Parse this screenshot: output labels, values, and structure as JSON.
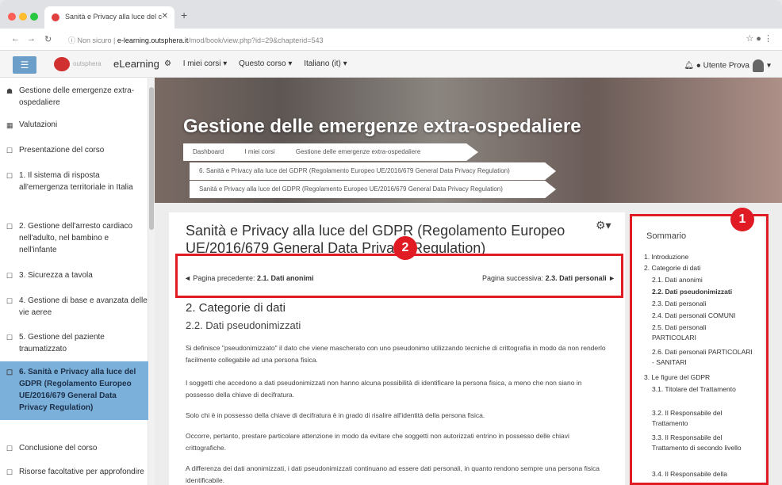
{
  "browser": {
    "tab_title": "Sanità e Privacy alla luce del c",
    "url_prefix": "Non sicuro | ",
    "url_host": "e-learning.outsphera.it",
    "url_path": "/mod/book/view.php?id=29&chapterid=543"
  },
  "topnav": {
    "brand": "outsphera",
    "brand_name": "eLearning",
    "items": [
      "I miei corsi ▾",
      "Questo corso ▾",
      "Italiano (it) ▾"
    ],
    "user": "Utente Prova"
  },
  "sidebar": {
    "items": [
      {
        "icon": "☗",
        "label": "Gestione delle emergenze extra-ospedaliere"
      },
      {
        "icon": "▦",
        "label": "Valutazioni"
      },
      {
        "icon": "☐",
        "label": "Presentazione del corso"
      },
      {
        "icon": "☐",
        "label": "1. Il sistema di risposta all'emergenza territoriale in Italia"
      },
      {
        "icon": "☐",
        "label": "2. Gestione dell'arresto cardiaco nell'adulto, nel bambino e nell'infante"
      },
      {
        "icon": "☐",
        "label": "3. Sicurezza a tavola"
      },
      {
        "icon": "☐",
        "label": "4. Gestione di base e avanzata delle vie aeree"
      },
      {
        "icon": "☐",
        "label": "5. Gestione del paziente traumatizzato"
      },
      {
        "icon": "☐",
        "label": "6. Sanità e Privacy alla luce del GDPR (Regolamento Europeo UE/2016/679 General Data Privacy Regulation)"
      },
      {
        "icon": "☐",
        "label": "Conclusione del corso"
      },
      {
        "icon": "☐",
        "label": "Risorse facoltative per approfondire"
      }
    ]
  },
  "header": {
    "title": "Gestione delle emergenze extra-ospedaliere",
    "crumbs": [
      "Dashboard",
      "I miei corsi",
      "Gestione delle emergenze extra-ospedaliere",
      "6. Sanità e Privacy alla luce del GDPR (Regolamento Europeo UE/2016/679 General Data Privacy Regulation)",
      "Sanità e Privacy alla luce del GDPR (Regolamento Europeo UE/2016/679 General Data Privacy Regulation)"
    ]
  },
  "content": {
    "title": "Sanità e Privacy alla luce del GDPR (Regolamento Europeo UE/2016/679 General Data Privacy Regulation)",
    "prev_label": "◄ Pagina precedente: ",
    "prev_link": "2.1. Dati anonimi",
    "next_label": "Pagina successiva: ",
    "next_link": "2.3. Dati personali ►",
    "h2": "2. Categorie di dati",
    "h3": "2.2. Dati pseudonimizzati",
    "paragraphs": [
      "Si definisce \"pseudonimizzato\" il dato che viene mascherato con uno pseudonimo utilizzando tecniche di crittografia in modo da non renderlo facilmente collegabile ad una persona fisica.",
      "I soggetti che accedono a dati pseudonimizzati non hanno alcuna possibilità di identificare la persona fisica, a meno che non siano in possesso della chiave di decifratura.",
      "Solo chi è in possesso della chiave di decifratura è in grado di risalire all'identità della persona fisica.",
      "Occorre, pertanto, prestare particolare attenzione in modo da evitare che soggetti non autorizzati entrino in possesso delle chiavi crittografiche.",
      "A differenza dei dati anonimizzati, i dati pseudonimizzati continuano ad essere dati personali, in quanto rendono sempre una persona fisica identificabile."
    ]
  },
  "toc": {
    "title": "Sommario",
    "items": [
      {
        "t": "1. Introduzione",
        "lvl": 0
      },
      {
        "t": "2. Categorie di dati",
        "lvl": 0
      },
      {
        "t": "2.1. Dati anonimi",
        "lvl": 1
      },
      {
        "t": "2.2. Dati pseudonimizzati",
        "lvl": 1,
        "bold": true
      },
      {
        "t": "2.3. Dati personali",
        "lvl": 1
      },
      {
        "t": "2.4. Dati personali COMUNI",
        "lvl": 1
      },
      {
        "t": "2.5. Dati personali PARTICOLARI",
        "lvl": 1
      },
      {
        "t": "2.6. Dati personali PARTICOLARI - SANITARI",
        "lvl": 1
      },
      {
        "t": "3. Le figure del GDPR",
        "lvl": 0
      },
      {
        "t": "3.1. Titolare del Trattamento",
        "lvl": 1
      },
      {
        "t": "3.2. Il Responsabile del Trattamento",
        "lvl": 1
      },
      {
        "t": "3.3. Il Responsabile del Trattamento di secondo livello",
        "lvl": 1
      },
      {
        "t": "3.4. Il Responsabile della",
        "lvl": 1
      }
    ]
  },
  "annotations": {
    "badge1": "1",
    "badge2": "2"
  },
  "colors": {
    "accent": "#7ab0da",
    "annotation_red": "#e01b24"
  }
}
